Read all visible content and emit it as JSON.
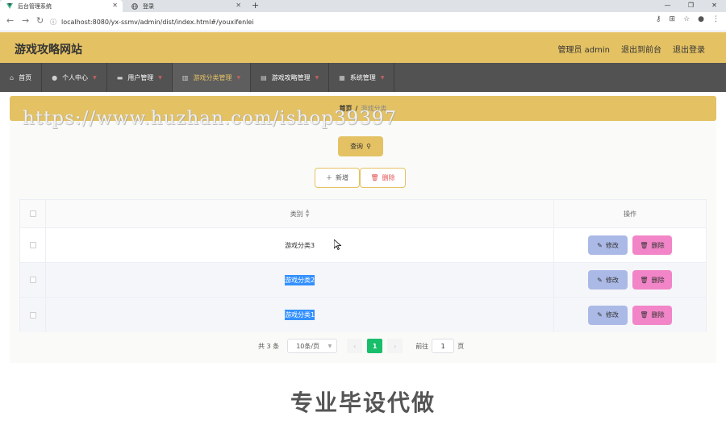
{
  "browser": {
    "tabs": [
      {
        "title": "后台管理系统",
        "active": true
      },
      {
        "title": "登录",
        "active": false
      }
    ],
    "url": "localhost:8080/yx-ssmv/admin/dist/index.html#/youxifenlei"
  },
  "header": {
    "site_title": "游戏攻略网站",
    "user_label": "管理员 admin",
    "exit_to_front": "退出到前台",
    "logout": "退出登录"
  },
  "nav": {
    "items": [
      {
        "label": "首页",
        "icon": "home-icon"
      },
      {
        "label": "个人中心",
        "icon": "user-icon"
      },
      {
        "label": "用户管理",
        "icon": "users-icon"
      },
      {
        "label": "游戏分类管理",
        "icon": "chart-icon"
      },
      {
        "label": "游戏攻略管理",
        "icon": "calendar-icon"
      },
      {
        "label": "系统管理",
        "icon": "file-icon"
      }
    ],
    "active_index": 3
  },
  "breadcrumb": {
    "home": "首页",
    "separator": "/",
    "current": "游戏分类"
  },
  "toolbar": {
    "query_label": "查询",
    "add_label": "新增",
    "delete_label": "删除"
  },
  "table": {
    "columns": [
      "类别",
      "操作"
    ],
    "rows": [
      {
        "category": "游戏分类3",
        "selected": false
      },
      {
        "category": "游戏分类2",
        "selected": true
      },
      {
        "category": "游戏分类1",
        "selected": true
      }
    ],
    "edit_label": "修改",
    "delete_label": "删除"
  },
  "pagination": {
    "total_text": "共 3 条",
    "page_size": "10条/页",
    "current_page": "1",
    "goto_prefix": "前往",
    "goto_value": "1",
    "goto_suffix": "页"
  },
  "watermarks": {
    "url": "https://www.huzhan.com/ishop39397",
    "bottom": "专业毕设代做"
  },
  "colors": {
    "accent": "#e4c264",
    "nav_bg": "#525252",
    "edit_btn": "#abb9e6",
    "delete_btn": "#f285c7",
    "page_active": "#19be6b"
  }
}
